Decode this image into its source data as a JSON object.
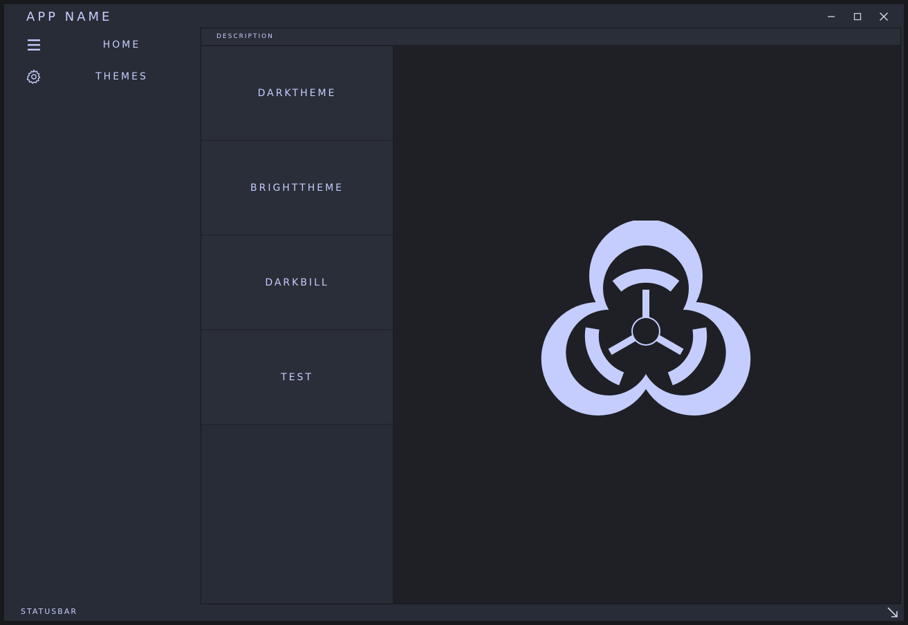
{
  "window": {
    "title": "APP NAME",
    "controls": {
      "minimize": "minimize-icon",
      "maximize": "maximize-icon",
      "close": "close-icon"
    }
  },
  "sidebar": {
    "items": [
      {
        "label": "HOME",
        "icon": "hamburger-menu-icon"
      },
      {
        "label": "THEMES",
        "icon": "gear-icon"
      }
    ]
  },
  "content": {
    "description_label": "DESCRIPTION",
    "themes": [
      {
        "label": "DARKTHEME"
      },
      {
        "label": "BRIGHTTHEME"
      },
      {
        "label": "DARKBILL"
      },
      {
        "label": "TEST"
      }
    ],
    "preview_icon": "biohazard-icon"
  },
  "statusbar": {
    "text": "STATUSBAR",
    "grip_icon": "resize-grip-icon"
  },
  "colors": {
    "accent": "#c5cdff",
    "background": "#282c36",
    "panel": "#1e2026"
  }
}
